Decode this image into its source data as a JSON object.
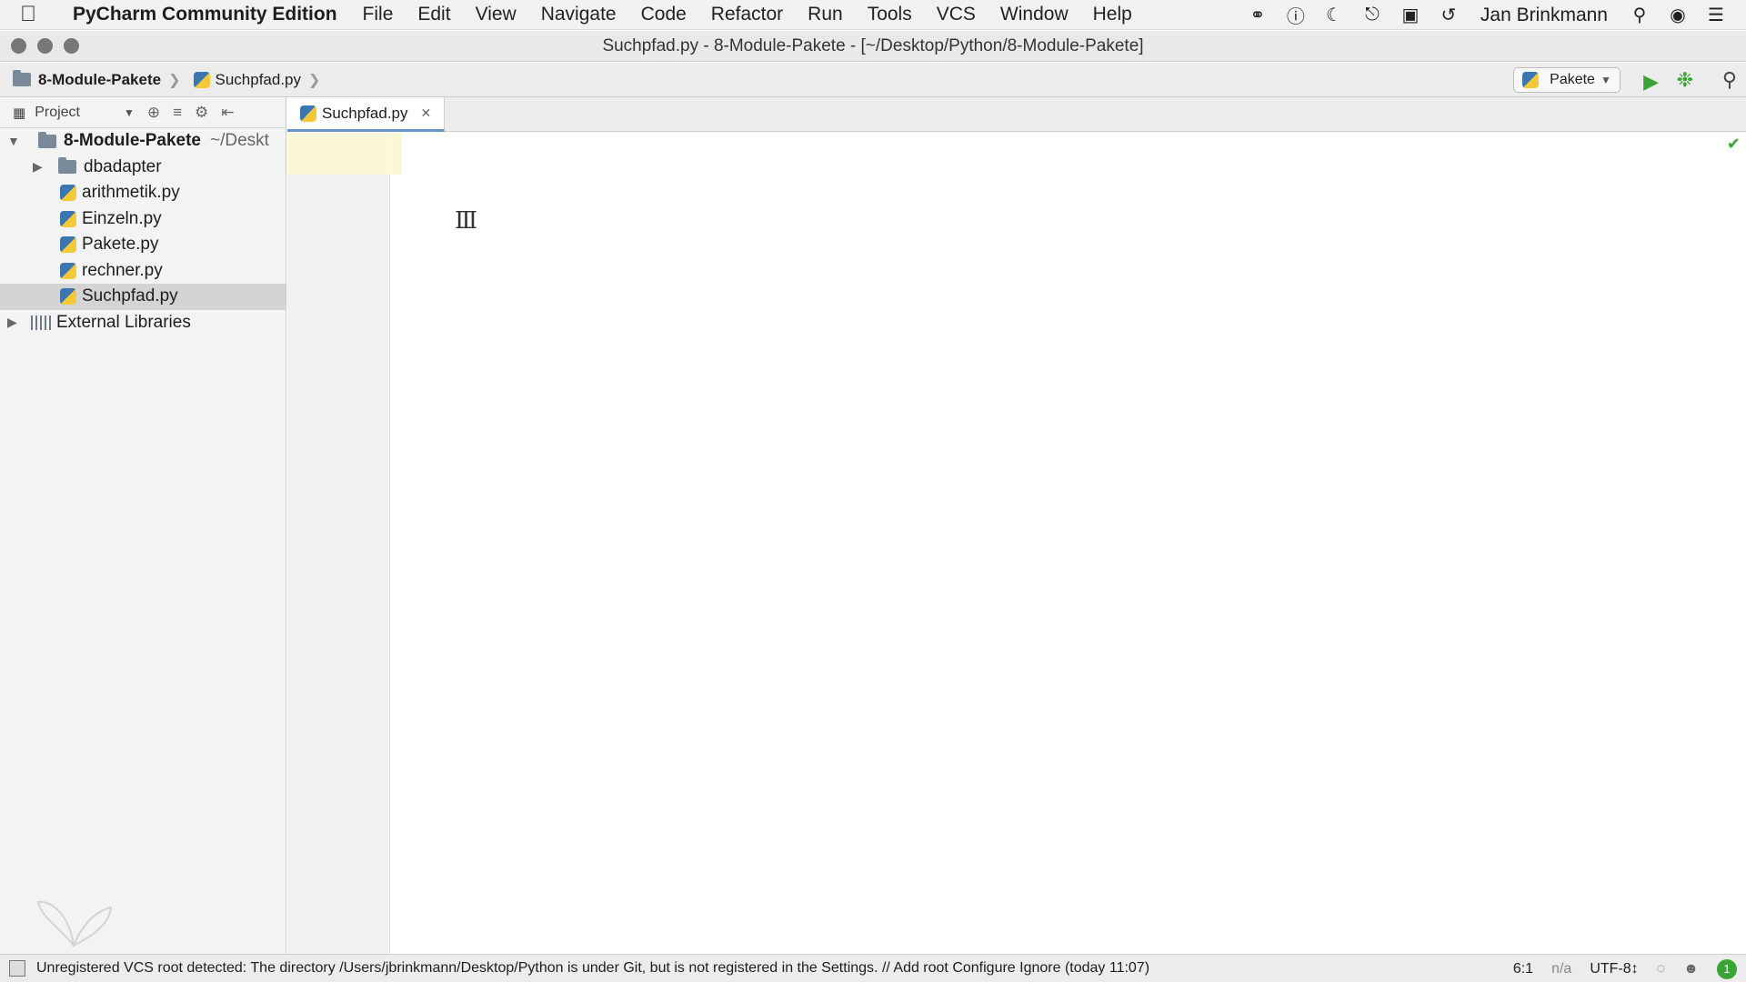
{
  "menubar": {
    "apple_icon": "apple-icon",
    "app_name": "PyCharm Community Edition",
    "items": [
      "File",
      "Edit",
      "View",
      "Navigate",
      "Code",
      "Refactor",
      "Run",
      "Tools",
      "VCS",
      "Window",
      "Help"
    ],
    "user": "Jan Brinkmann"
  },
  "window": {
    "title": "Suchpfad.py - 8-Module-Pakete - [~/Desktop/Python/8-Module-Pakete]"
  },
  "navbar": {
    "crumbs": [
      "8-Module-Pakete",
      "Suchpfad.py"
    ],
    "run_config": "Pakete"
  },
  "project_panel": {
    "header": "Project",
    "root": {
      "name": "8-Module-Pakete",
      "path": "~/Deskt"
    },
    "items": [
      {
        "label": "dbadapter",
        "type": "folder"
      },
      {
        "label": "arithmetik.py",
        "type": "file"
      },
      {
        "label": "Einzeln.py",
        "type": "file"
      },
      {
        "label": "Pakete.py",
        "type": "file"
      },
      {
        "label": "rechner.py",
        "type": "file"
      },
      {
        "label": "Suchpfad.py",
        "type": "file",
        "selected": true
      }
    ],
    "external": "External Libraries"
  },
  "editor": {
    "tab_label": "Suchpfad.py"
  },
  "statusbar": {
    "message": "Unregistered VCS root detected: The directory /Users/jbrinkmann/Desktop/Python is under Git, but is not registered in the Settings. // Add root  Configure  Ignore (today 11:07)",
    "position": "6:1",
    "vcs": "n/a",
    "encoding": "UTF-8↕"
  },
  "colors": {
    "run_green": "#3aa536",
    "selection": "#d4d4d4",
    "tab_underline": "#6a94c4"
  }
}
